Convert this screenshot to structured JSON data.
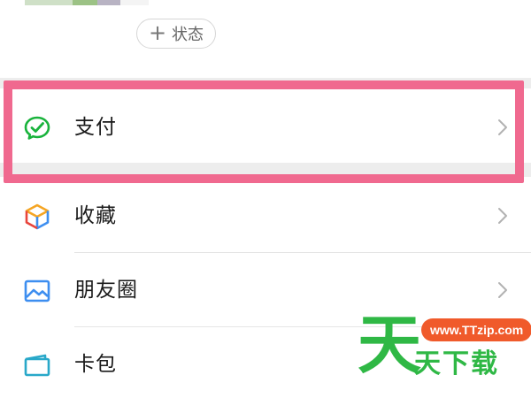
{
  "profile": {
    "status_button": {
      "plus": "+",
      "label": "状态"
    },
    "swatch_colors": [
      "#cfe0c7",
      "#9cc285",
      "#b8b3c3",
      "#f4f4f4"
    ]
  },
  "menu": [
    {
      "id": "pay",
      "label": "支付",
      "icon": "wechat-pay-icon",
      "color": "#19b33c"
    },
    {
      "id": "favorites",
      "label": "收藏",
      "icon": "favorites-cube-icon",
      "colors": [
        "#f5a524",
        "#3d8ef0",
        "#e8453c"
      ]
    },
    {
      "id": "moments",
      "label": "朋友圈",
      "icon": "moments-picture-icon",
      "color": "#3d8ef0"
    },
    {
      "id": "cards",
      "label": "卡包",
      "icon": "card-wallet-icon",
      "color": "#29a8c9"
    }
  ],
  "highlight_color": "#f0698f",
  "watermark": {
    "big_char": "天",
    "url": "www.TTzip.com",
    "text": "天下载"
  }
}
